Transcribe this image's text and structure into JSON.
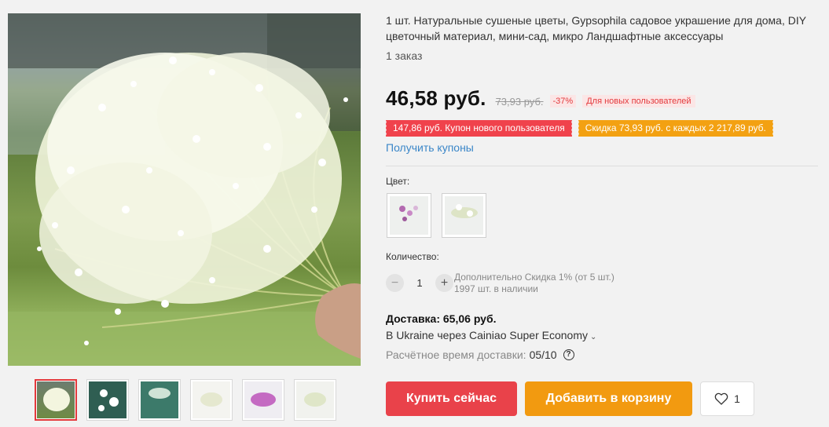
{
  "product": {
    "title": "1 шт. Натуральные сушеные цветы, Gypsophila садовое украшение для дома, DIY цветочный материал, мини-сад, микро Ландшафтные аксессуары",
    "orders": "1 заказ"
  },
  "pricing": {
    "price": "46,58 руб.",
    "old_price": "73,93 руб.",
    "discount": "-37%",
    "new_user_badge": "Для новых пользователей"
  },
  "coupons": {
    "new_user_coupon": "147,86 руб. Купон нового пользователя",
    "store_discount": "Скидка 73,93 руб. с каждых 2 217,89 руб.",
    "get_coupons_link": "Получить купоны"
  },
  "color": {
    "label": "Цвет:",
    "options": [
      "purple-white gypsophila",
      "white gypsophila"
    ]
  },
  "quantity": {
    "label": "Количество:",
    "value": "1",
    "minus_symbol": "−",
    "plus_symbol": "+",
    "extra_discount": "Дополнительно Скидка 1% (от 5 шт.)",
    "stock": "1997 шт. в наличии"
  },
  "shipping": {
    "price": "Доставка: 65,06 руб.",
    "via": "В Ukraine через Cainiao Super Economy",
    "chevron": "⌄",
    "time_label": "Расчётное время доставки:",
    "time_value": "05/10",
    "help_symbol": "?"
  },
  "actions": {
    "buy_now": "Купить сейчас",
    "add_to_cart": "Добавить в корзину",
    "wishlist_count": "1"
  },
  "colors": {
    "accent_red": "#e9424a",
    "accent_orange": "#f29a10",
    "link_blue": "#3a86c8"
  },
  "icons": [
    "heart-icon",
    "help-icon",
    "chevron-down-icon"
  ]
}
